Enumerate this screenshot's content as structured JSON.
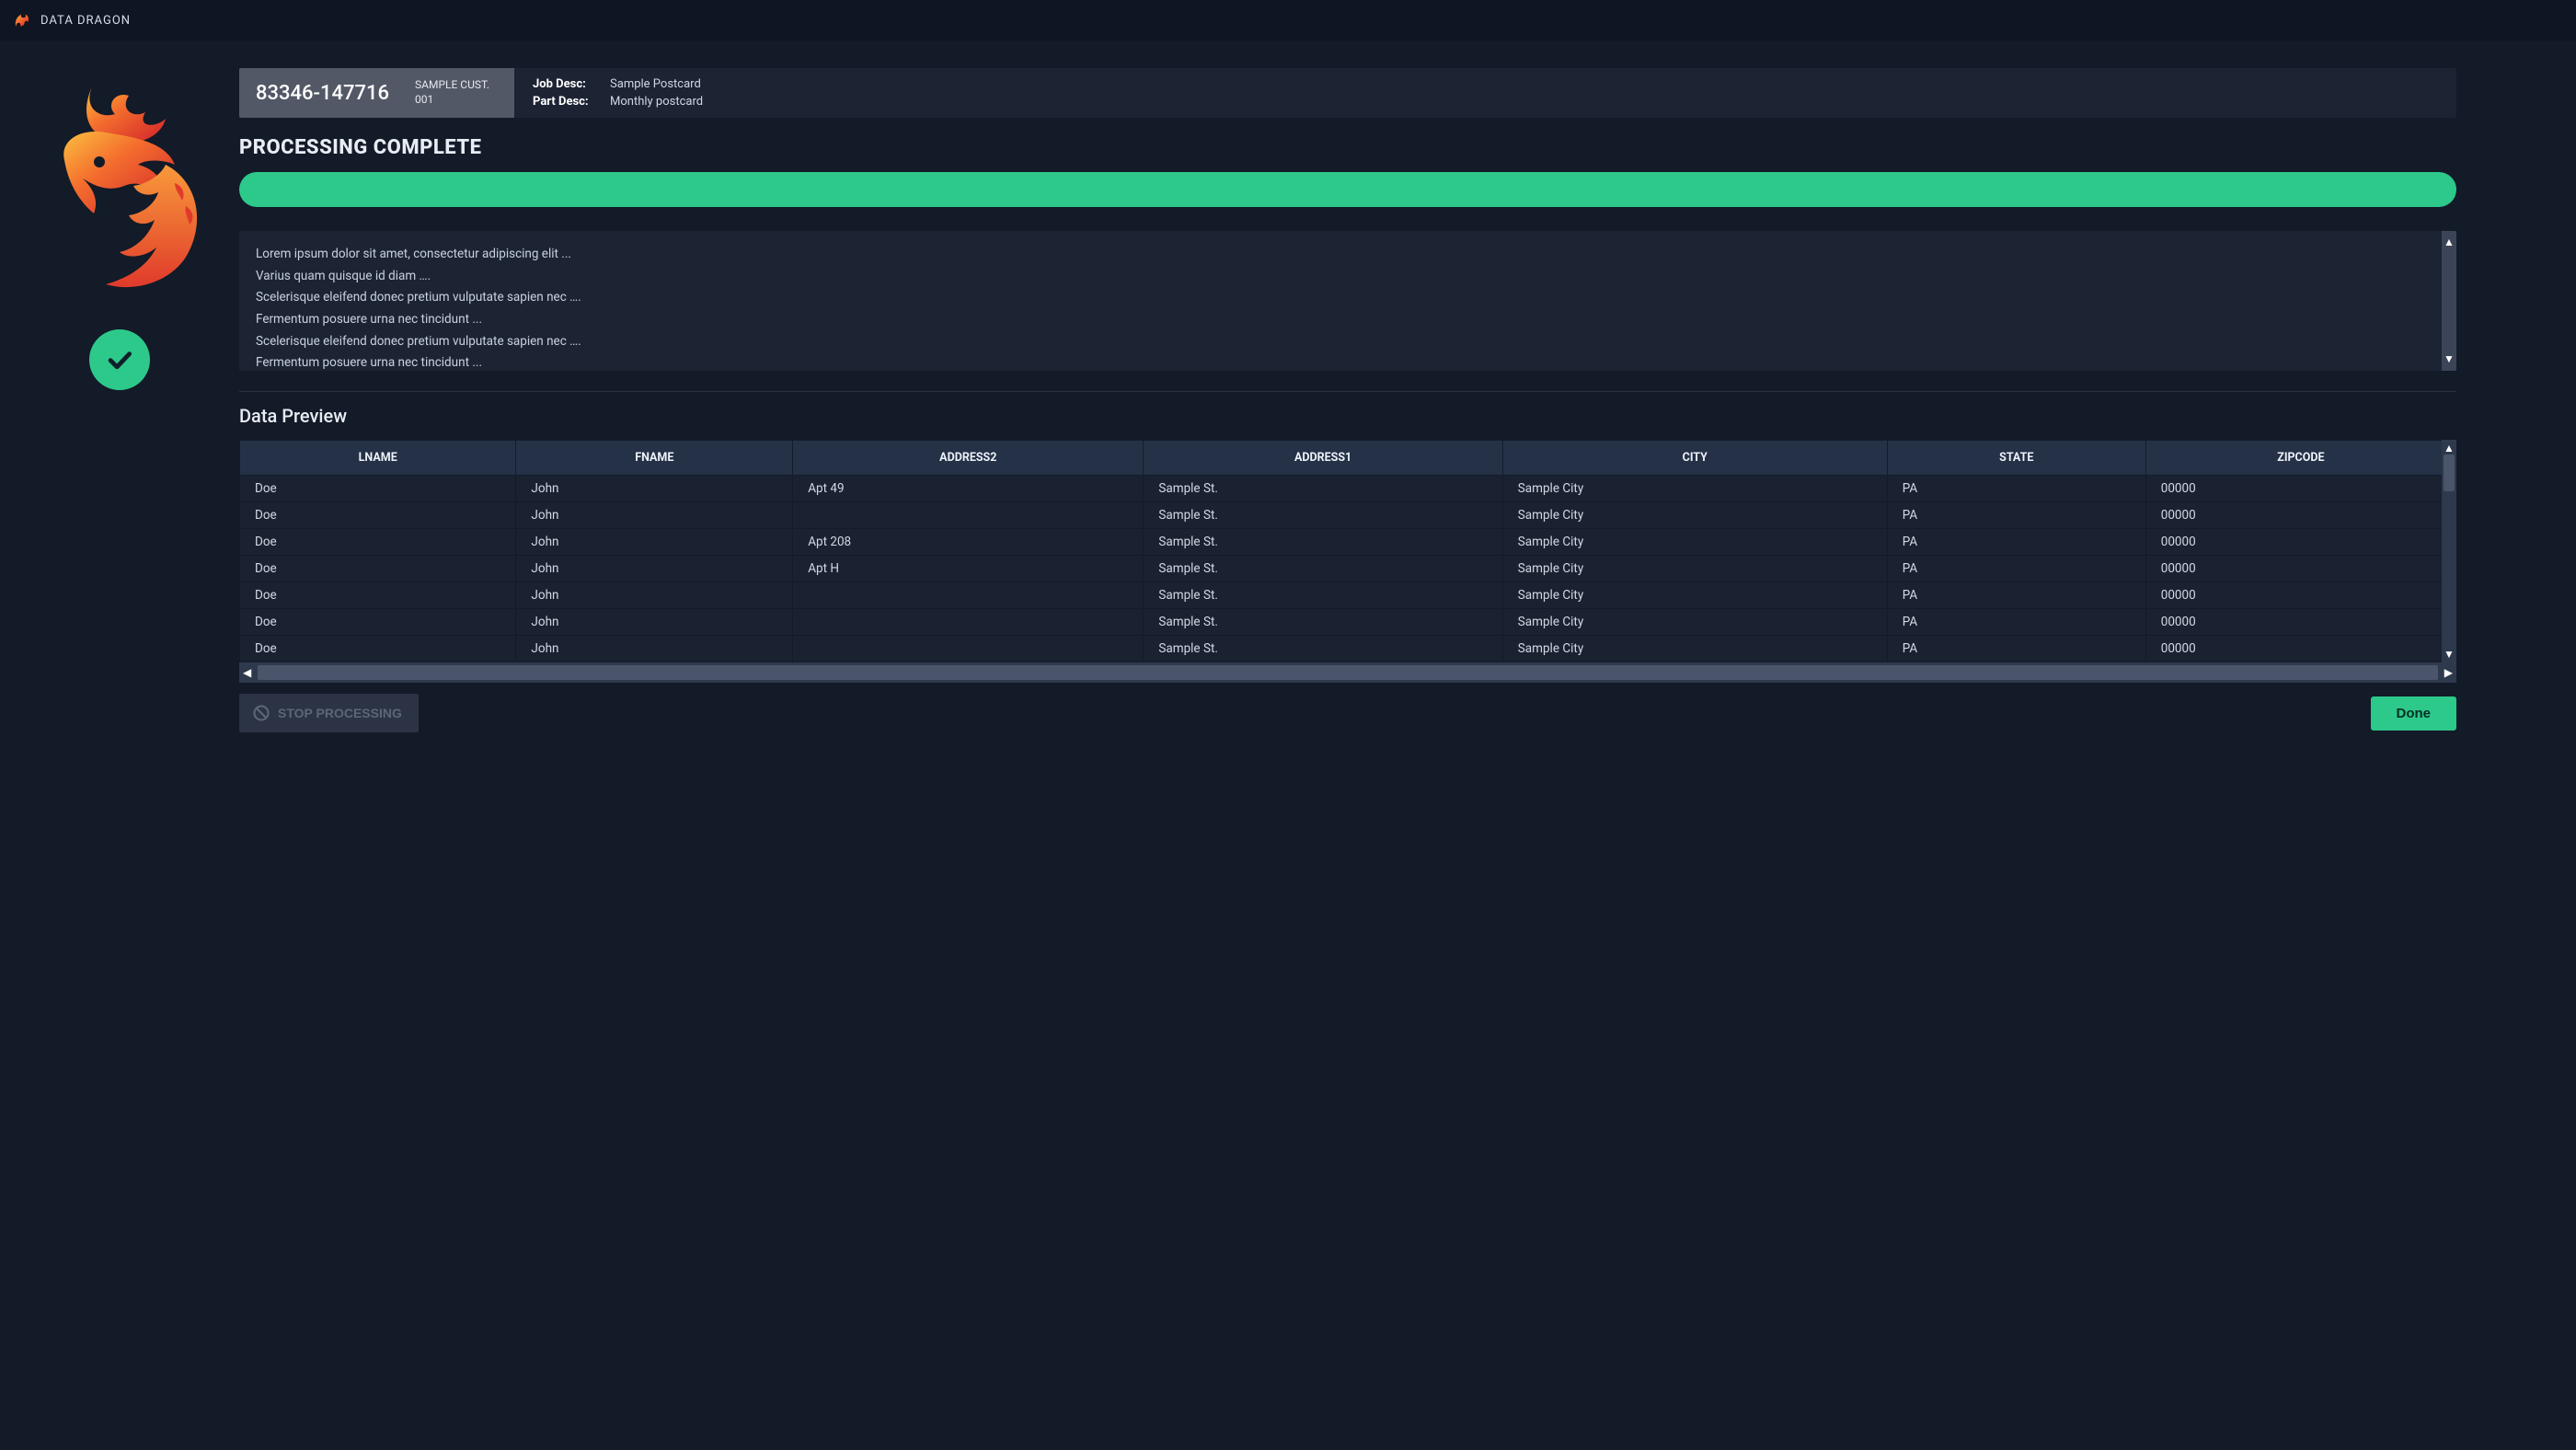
{
  "app": {
    "title": "DATA DRAGON"
  },
  "job": {
    "number": "83346-147716",
    "customer": "SAMPLE CUST. 001",
    "job_desc_label": "Job Desc:",
    "job_desc_value": "Sample Postcard",
    "part_desc_label": "Part Desc:",
    "part_desc_value": "Monthly postcard"
  },
  "status": {
    "title": "PROCESSING COMPLETE",
    "progress_pct": 100
  },
  "log": {
    "lines": [
      "Lorem ipsum dolor sit amet, consectetur adipiscing elit ...",
      "Varius quam quisque id diam ….",
      "Scelerisque eleifend donec pretium vulputate sapien nec ….",
      "Fermentum posuere urna nec tincidunt ...",
      "Scelerisque eleifend donec pretium vulputate sapien nec ….",
      "Fermentum posuere urna nec tincidunt ..."
    ]
  },
  "preview": {
    "title": "Data Preview",
    "columns": [
      "LNAME",
      "FNAME",
      "ADDRESS2",
      "ADDRESS1",
      "CITY",
      "STATE",
      "ZIPCODE"
    ],
    "rows": [
      [
        "Doe",
        "John",
        "Apt 49",
        "Sample St.",
        "Sample City",
        "PA",
        "00000"
      ],
      [
        "Doe",
        "John",
        "",
        "Sample St.",
        "Sample City",
        "PA",
        "00000"
      ],
      [
        "Doe",
        "John",
        "Apt 208",
        "Sample St.",
        "Sample City",
        "PA",
        "00000"
      ],
      [
        "Doe",
        "John",
        "Apt H",
        "Sample St.",
        "Sample City",
        "PA",
        "00000"
      ],
      [
        "Doe",
        "John",
        "",
        "Sample St.",
        "Sample City",
        "PA",
        "00000"
      ],
      [
        "Doe",
        "John",
        "",
        "Sample St.",
        "Sample City",
        "PA",
        "00000"
      ],
      [
        "Doe",
        "John",
        "",
        "Sample St.",
        "Sample City",
        "PA",
        "00000"
      ]
    ]
  },
  "buttons": {
    "stop": "STOP PROCESSING",
    "done": "Done"
  },
  "colors": {
    "accent": "#2dc98b",
    "bg": "#131a28",
    "panel": "#1c2434"
  }
}
